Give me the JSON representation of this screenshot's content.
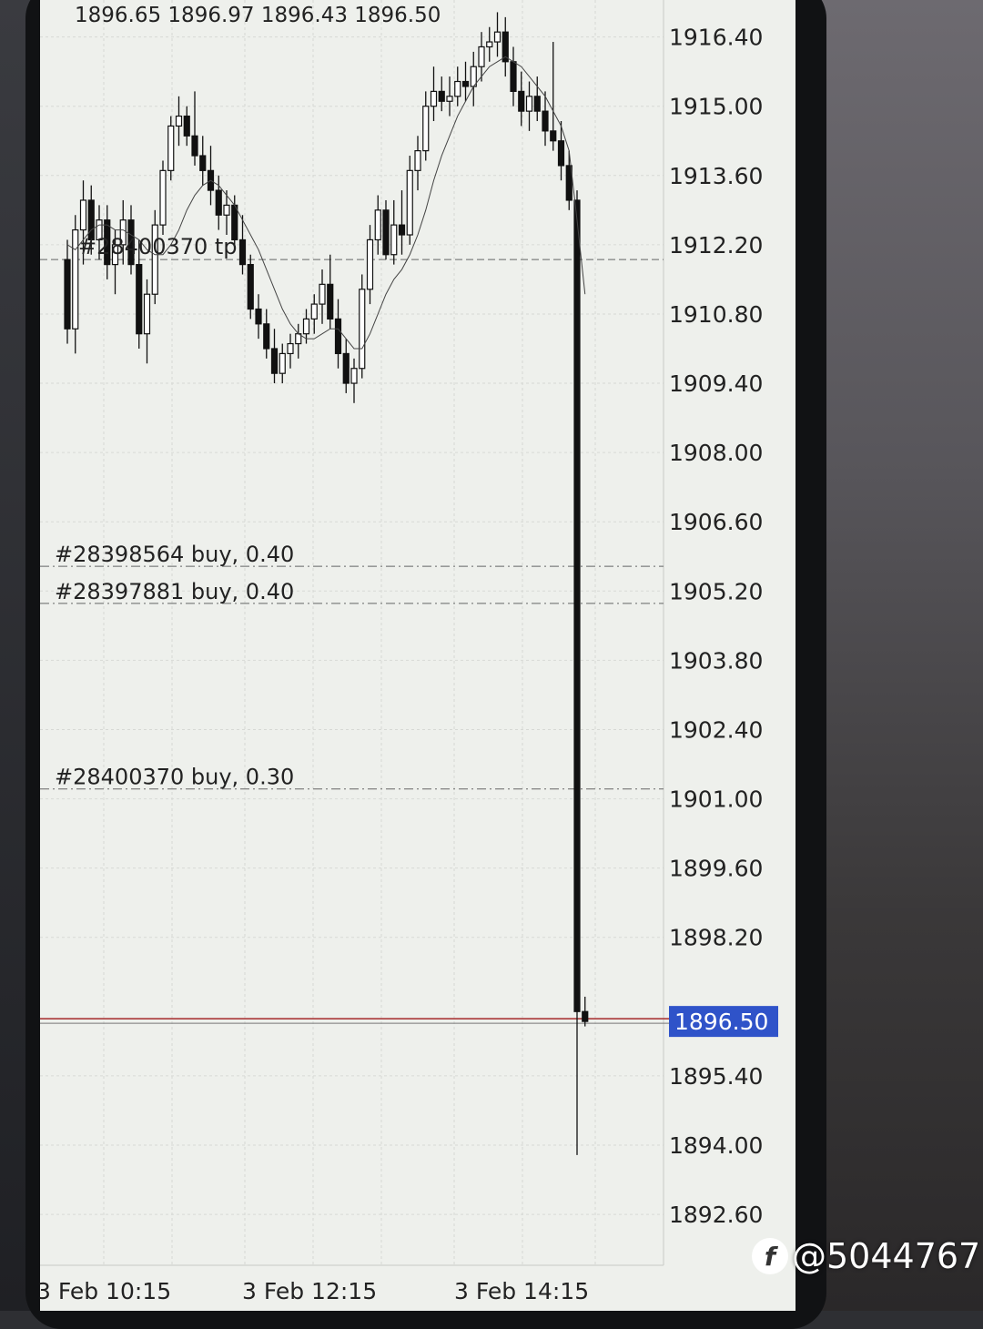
{
  "ohlc_header": "1896.65 1896.97 1896.43 1896.50",
  "tp_label": "#28400370 tp",
  "orders": [
    {
      "label": "#28398564 buy, 0.40",
      "price": 1905.7
    },
    {
      "label": "#28397881 buy, 0.40",
      "price": 1904.95
    },
    {
      "label": "#28400370 buy, 0.30",
      "price": 1901.2
    }
  ],
  "tp_price": 1911.9,
  "current_price": "1896.50",
  "price_axis_labels": [
    "1916.40",
    "1915.00",
    "1913.60",
    "1912.20",
    "1910.80",
    "1909.40",
    "1908.00",
    "1906.60",
    "1905.20",
    "1903.80",
    "1902.40",
    "1901.00",
    "1899.60",
    "1898.20",
    "1895.40",
    "1894.00",
    "1892.60"
  ],
  "time_axis_labels": [
    "3 Feb 10:15",
    "3 Feb 12:15",
    "3 Feb 14:15"
  ],
  "watermark": "@5044767",
  "colors": {
    "price_tag_bg": "#2f53c9",
    "bid_line": "#a52a2a",
    "candle": "#111111"
  },
  "chart_data": {
    "type": "candlestick",
    "y_unit": "price",
    "candles": [
      [
        1911.9,
        1912.3,
        1910.2,
        1910.5
      ],
      [
        1910.5,
        1912.8,
        1910.0,
        1912.5
      ],
      [
        1912.5,
        1913.5,
        1911.8,
        1913.1
      ],
      [
        1913.1,
        1913.4,
        1912.0,
        1912.3
      ],
      [
        1912.3,
        1913.0,
        1911.9,
        1912.7
      ],
      [
        1912.7,
        1913.0,
        1911.5,
        1911.8
      ],
      [
        1911.8,
        1912.5,
        1911.2,
        1912.2
      ],
      [
        1912.2,
        1913.1,
        1911.8,
        1912.7
      ],
      [
        1912.7,
        1913.0,
        1911.6,
        1911.8
      ],
      [
        1911.8,
        1912.3,
        1910.1,
        1910.4
      ],
      [
        1910.4,
        1911.5,
        1909.8,
        1911.2
      ],
      [
        1911.2,
        1912.9,
        1911.0,
        1912.6
      ],
      [
        1912.6,
        1913.9,
        1912.4,
        1913.7
      ],
      [
        1913.7,
        1914.8,
        1913.5,
        1914.6
      ],
      [
        1914.6,
        1915.2,
        1914.2,
        1914.8
      ],
      [
        1914.8,
        1915.0,
        1914.2,
        1914.4
      ],
      [
        1914.4,
        1915.3,
        1913.8,
        1914.0
      ],
      [
        1914.0,
        1914.4,
        1913.4,
        1913.7
      ],
      [
        1913.7,
        1914.2,
        1913.0,
        1913.3
      ],
      [
        1913.3,
        1913.6,
        1912.5,
        1912.8
      ],
      [
        1912.8,
        1913.3,
        1912.4,
        1913.0
      ],
      [
        1913.0,
        1913.2,
        1912.1,
        1912.3
      ],
      [
        1912.3,
        1912.8,
        1911.6,
        1911.8
      ],
      [
        1911.8,
        1912.0,
        1910.7,
        1910.9
      ],
      [
        1910.9,
        1911.2,
        1910.3,
        1910.6
      ],
      [
        1910.6,
        1910.9,
        1909.9,
        1910.1
      ],
      [
        1910.1,
        1910.5,
        1909.4,
        1909.6
      ],
      [
        1909.6,
        1910.2,
        1909.4,
        1910.0
      ],
      [
        1910.0,
        1910.4,
        1909.7,
        1910.2
      ],
      [
        1910.2,
        1910.6,
        1909.9,
        1910.4
      ],
      [
        1910.4,
        1910.9,
        1910.2,
        1910.7
      ],
      [
        1910.7,
        1911.2,
        1910.4,
        1911.0
      ],
      [
        1911.0,
        1911.7,
        1910.6,
        1911.4
      ],
      [
        1911.4,
        1912.0,
        1910.5,
        1910.7
      ],
      [
        1910.7,
        1911.1,
        1909.7,
        1910.0
      ],
      [
        1910.0,
        1910.3,
        1909.2,
        1909.4
      ],
      [
        1909.4,
        1909.9,
        1909.0,
        1909.7
      ],
      [
        1909.7,
        1911.6,
        1909.5,
        1911.3
      ],
      [
        1911.3,
        1912.6,
        1911.0,
        1912.3
      ],
      [
        1912.3,
        1913.2,
        1912.0,
        1912.9
      ],
      [
        1912.9,
        1913.1,
        1911.9,
        1912.0
      ],
      [
        1912.0,
        1913.1,
        1911.8,
        1912.6
      ],
      [
        1912.6,
        1913.3,
        1912.0,
        1912.4
      ],
      [
        1912.4,
        1914.0,
        1912.2,
        1913.7
      ],
      [
        1913.7,
        1914.4,
        1913.3,
        1914.1
      ],
      [
        1914.1,
        1915.3,
        1913.9,
        1915.0
      ],
      [
        1915.0,
        1915.8,
        1914.7,
        1915.3
      ],
      [
        1915.3,
        1915.6,
        1914.9,
        1915.1
      ],
      [
        1915.1,
        1915.6,
        1914.8,
        1915.2
      ],
      [
        1915.2,
        1915.8,
        1915.0,
        1915.5
      ],
      [
        1915.5,
        1915.9,
        1915.1,
        1915.4
      ],
      [
        1915.4,
        1916.1,
        1915.0,
        1915.8
      ],
      [
        1915.8,
        1916.5,
        1915.5,
        1916.2
      ],
      [
        1916.2,
        1916.6,
        1915.9,
        1916.3
      ],
      [
        1916.3,
        1916.9,
        1916.0,
        1916.5
      ],
      [
        1916.5,
        1916.8,
        1915.6,
        1915.9
      ],
      [
        1915.9,
        1916.2,
        1915.0,
        1915.3
      ],
      [
        1915.3,
        1915.7,
        1914.6,
        1914.9
      ],
      [
        1914.9,
        1915.5,
        1914.5,
        1915.2
      ],
      [
        1915.2,
        1915.6,
        1914.7,
        1914.9
      ],
      [
        1914.9,
        1915.3,
        1914.2,
        1914.5
      ],
      [
        1914.5,
        1916.3,
        1914.1,
        1914.3
      ],
      [
        1914.3,
        1914.7,
        1913.5,
        1913.8
      ],
      [
        1913.8,
        1914.1,
        1912.9,
        1913.1
      ],
      [
        1913.1,
        1913.3,
        1893.8,
        1896.7
      ],
      [
        1896.7,
        1897.0,
        1896.4,
        1896.5
      ]
    ],
    "moving_average": [
      1912.2,
      1912.1,
      1912.3,
      1912.5,
      1912.6,
      1912.6,
      1912.5,
      1912.5,
      1912.4,
      1912.3,
      1912.1,
      1912.0,
      1912.0,
      1912.2,
      1912.5,
      1912.9,
      1913.2,
      1913.4,
      1913.5,
      1913.4,
      1913.2,
      1913.0,
      1912.7,
      1912.4,
      1912.1,
      1911.7,
      1911.3,
      1910.9,
      1910.6,
      1910.4,
      1910.3,
      1910.3,
      1910.4,
      1910.5,
      1910.5,
      1910.3,
      1910.1,
      1910.1,
      1910.4,
      1910.8,
      1911.2,
      1911.5,
      1911.7,
      1912.0,
      1912.4,
      1912.9,
      1913.5,
      1914.0,
      1914.4,
      1914.8,
      1915.1,
      1915.4,
      1915.6,
      1915.8,
      1915.9,
      1916.0,
      1915.9,
      1915.8,
      1915.6,
      1915.4,
      1915.2,
      1914.9,
      1914.6,
      1914.1,
      1912.7,
      1911.2
    ],
    "ylim": [
      1892.0,
      1917.0
    ]
  }
}
